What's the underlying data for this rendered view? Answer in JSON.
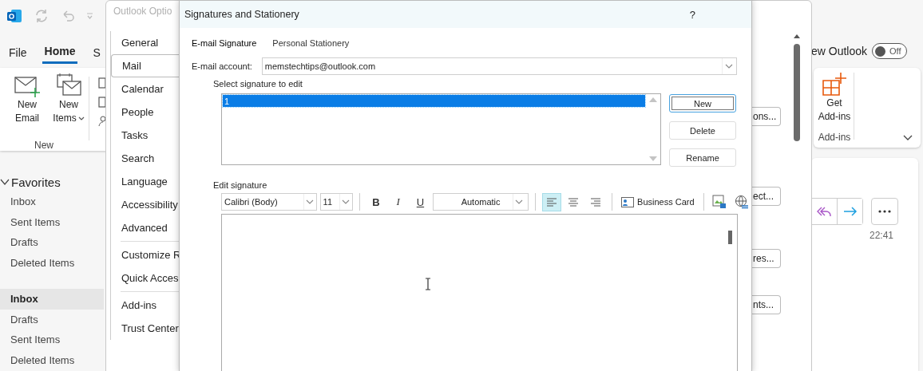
{
  "ribbon": {
    "tabs": [
      {
        "label": "File",
        "selected": false
      },
      {
        "label": "Home",
        "selected": true
      },
      {
        "label": "S",
        "selected": false
      }
    ],
    "new_group": {
      "buttons": [
        {
          "kind": "email",
          "label": "New Email"
        },
        {
          "kind": "items",
          "label": "New Items"
        }
      ],
      "label": "New"
    },
    "new_outlook": {
      "label": "ew Outlook",
      "on": false,
      "state_text": "Off"
    },
    "addins_group": {
      "button": "Get Add-ins",
      "label": "Add-ins"
    }
  },
  "folders": {
    "favorites": {
      "label": "Favorites",
      "expanded": true,
      "items": [
        {
          "label": "Inbox",
          "selected": false
        },
        {
          "label": "Sent Items",
          "selected": false
        },
        {
          "label": "Drafts",
          "selected": false
        },
        {
          "label": "Deleted Items",
          "selected": false
        }
      ]
    },
    "account_items": [
      {
        "label": "Inbox",
        "selected": true
      },
      {
        "label": "Drafts",
        "selected": false
      },
      {
        "label": "Sent Items",
        "selected": false
      },
      {
        "label": "Deleted Items",
        "selected": false
      }
    ]
  },
  "message": {
    "time": "22:41"
  },
  "options_window": {
    "title": "Outlook Optio",
    "nav": [
      {
        "label": "General",
        "selected": false
      },
      {
        "label": "Mail",
        "selected": true
      },
      {
        "label": "Calendar",
        "selected": false
      },
      {
        "label": "People",
        "selected": false
      },
      {
        "label": "Tasks",
        "selected": false
      },
      {
        "label": "Search",
        "selected": false
      },
      {
        "label": "Language",
        "selected": false
      },
      {
        "label": "Accessibility",
        "selected": false
      },
      {
        "label": "Advanced",
        "selected": false,
        "divider_after": true
      },
      {
        "label": "Customize R",
        "selected": false
      },
      {
        "label": "Quick Acces",
        "selected": false,
        "divider_after": true
      },
      {
        "label": "Add-ins",
        "selected": false
      },
      {
        "label": "Trust Center",
        "selected": false
      }
    ],
    "side_buttons": [
      "ons...",
      "ect...",
      "res...",
      "nts..."
    ]
  },
  "dialog": {
    "title": "Signatures and Stationery",
    "help": "?",
    "tabs": [
      {
        "label": "E-mail Signature",
        "selected": true
      },
      {
        "label": "Personal Stationery",
        "selected": false
      }
    ],
    "account_label": "E-mail account:",
    "account_value": "memstechtips@outlook.com",
    "select_label": "Select signature to edit",
    "signatures": [
      {
        "label": "1",
        "selected": true
      }
    ],
    "buttons": [
      {
        "label": "New",
        "focused": true
      },
      {
        "label": "Delete",
        "focused": false
      },
      {
        "label": "Rename",
        "focused": false
      }
    ],
    "edit_label": "Edit signature",
    "toolbar": {
      "font": "Calibri (Body)",
      "size": "11",
      "bold": "B",
      "italic": "I",
      "underline": "U",
      "text_color": "Automatic",
      "align": [
        {
          "kind": "left",
          "selected": true
        },
        {
          "kind": "center",
          "selected": false
        },
        {
          "kind": "right",
          "selected": false
        }
      ],
      "business_card": "Business Card"
    }
  }
}
